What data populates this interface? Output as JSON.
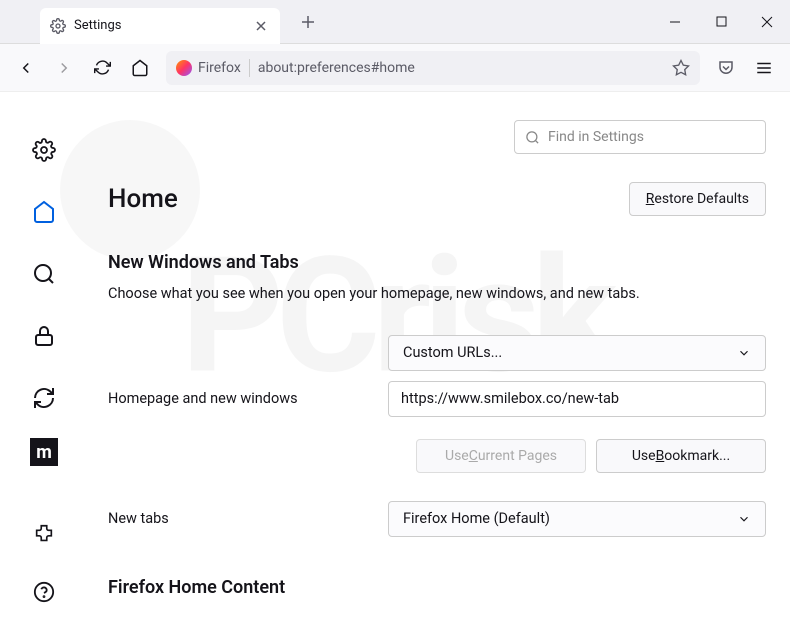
{
  "tab": {
    "title": "Settings"
  },
  "urlbar": {
    "identity": "Firefox",
    "url": "about:preferences#home"
  },
  "search": {
    "placeholder": "Find in Settings"
  },
  "page": {
    "heading": "Home",
    "restore_btn": "Restore Defaults",
    "section_title": "New Windows and Tabs",
    "section_desc": "Choose what you see when you open your homepage, new windows, and new tabs.",
    "homepage_label": "Homepage and new windows",
    "homepage_select": "Custom URLs...",
    "homepage_url": "https://www.smilebox.co/new-tab",
    "use_current": "Use Current Pages",
    "use_bookmark": "Use Bookmark...",
    "newtabs_label": "New tabs",
    "newtabs_select": "Firefox Home (Default)",
    "fhc_title": "Firefox Home Content"
  },
  "sidebar": {
    "m_label": "m"
  }
}
